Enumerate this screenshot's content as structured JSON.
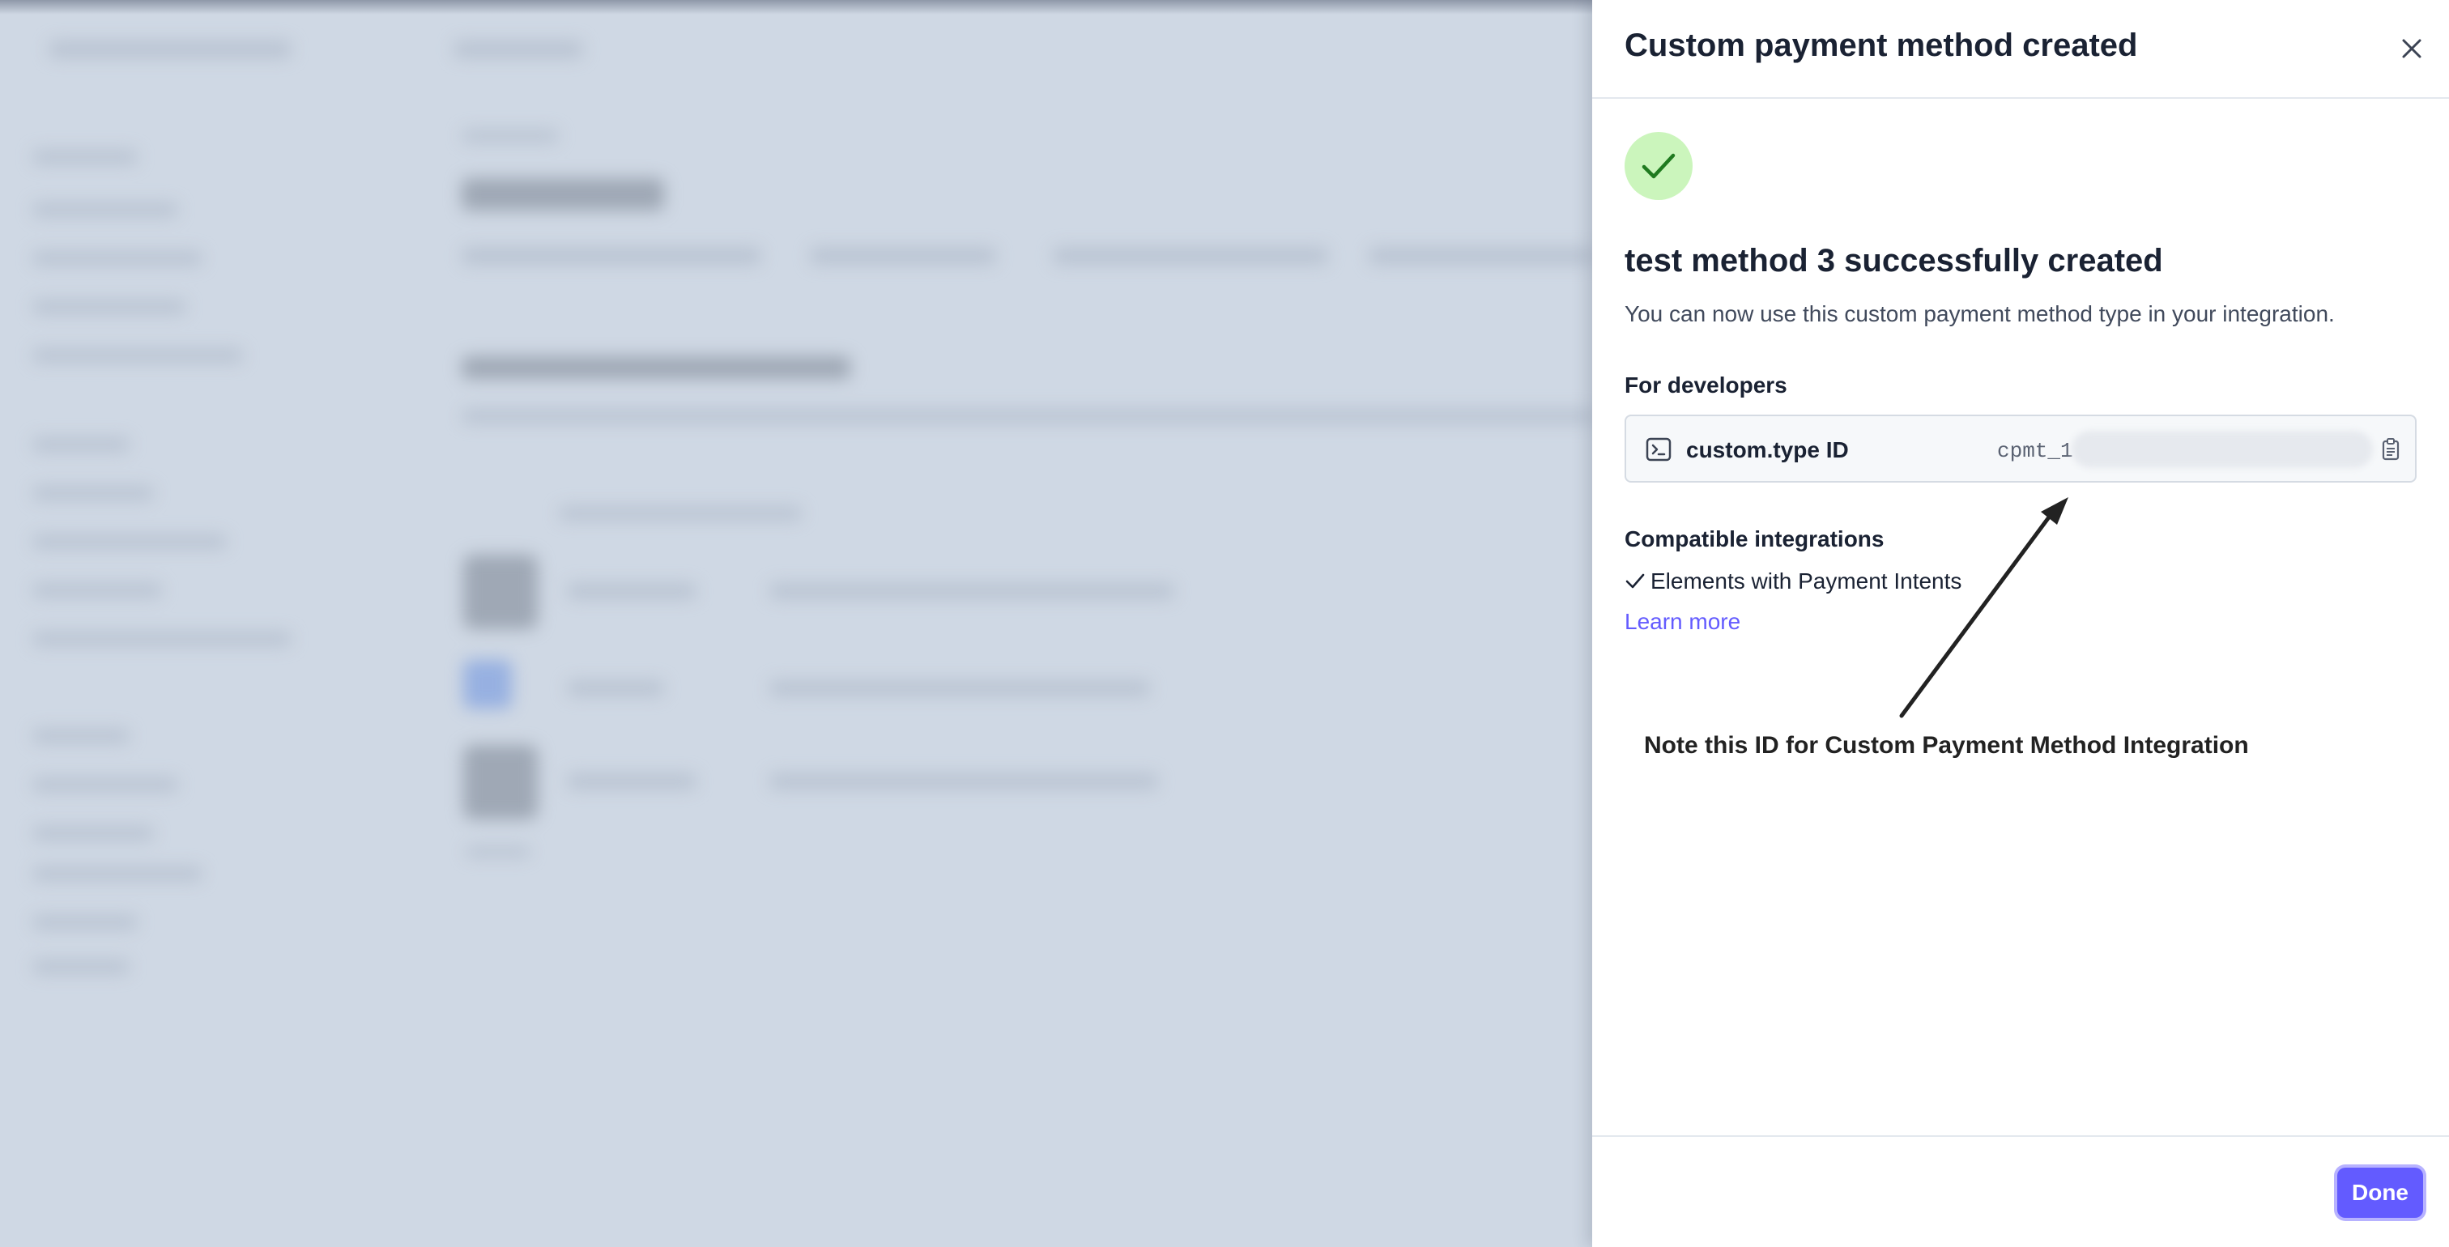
{
  "drawer": {
    "title": "Custom payment method created",
    "close_icon": "close-icon",
    "success_icon": "checkmark-icon",
    "heading": "test method 3 successfully created",
    "subtext": "You can now use this custom payment method type in your integration.",
    "developers_label": "For developers",
    "id_label": "custom.type ID",
    "id_value": "cpmt_1",
    "compat_label": "Compatible integrations",
    "compat_item": "Elements with Payment Intents",
    "learn_more": "Learn more",
    "annotation": "Note this ID for Custom Payment Method Integration",
    "done_label": "Done"
  },
  "colors": {
    "accent": "#635bff",
    "success_bg": "#cbf5bc",
    "success_check": "#1f7a1f"
  }
}
